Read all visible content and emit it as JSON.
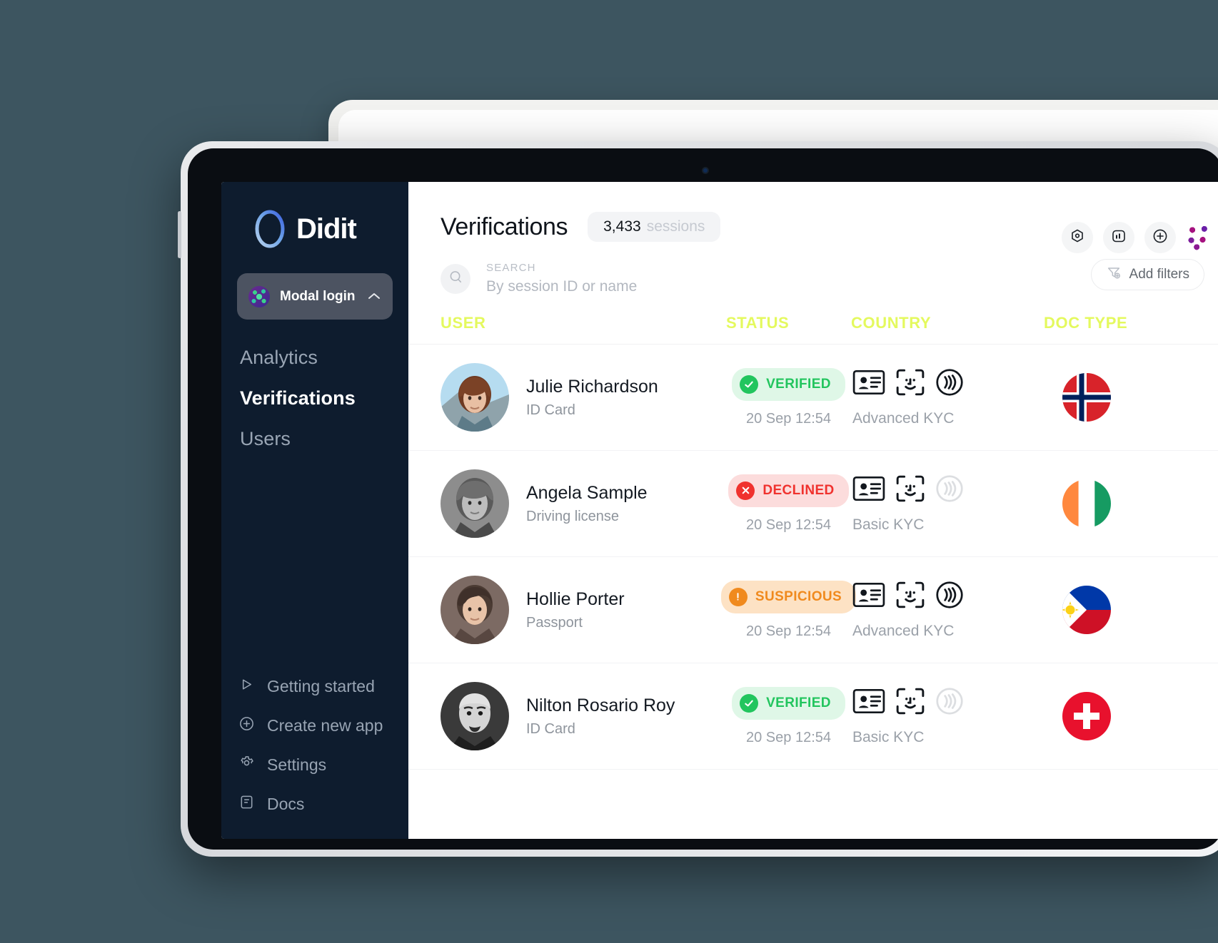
{
  "brand": {
    "name": "Didit",
    "logo_icon": "didit-ring-logo"
  },
  "app_switcher": {
    "label": "Modal login",
    "chevron": "chevron-up-icon",
    "avatar_icon": "app-avatar-identicon"
  },
  "sidebar": {
    "nav_main": [
      {
        "label": "Analytics",
        "active": false
      },
      {
        "label": "Verifications",
        "active": true
      },
      {
        "label": "Users",
        "active": false
      }
    ],
    "nav_bottom": [
      {
        "label": "Getting started",
        "icon": "play-outline-icon"
      },
      {
        "label": "Create new app",
        "icon": "plus-circle-icon"
      },
      {
        "label": "Settings",
        "icon": "gear-icon"
      },
      {
        "label": "Docs",
        "icon": "document-icon"
      }
    ]
  },
  "header": {
    "title": "Verifications",
    "sessions_count": "3,433",
    "sessions_unit": "sessions",
    "actions": [
      {
        "icon": "hexagon-target-icon"
      },
      {
        "icon": "bar-chart-icon"
      },
      {
        "icon": "plus-circle-icon"
      }
    ],
    "profile_icon": "user-dots-avatar"
  },
  "search": {
    "icon": "search-icon",
    "label": "SEARCH",
    "placeholder": "By session ID or name",
    "value": ""
  },
  "filters": {
    "label": "Add filters",
    "icon": "filter-plus-icon"
  },
  "table": {
    "header_color": "#e4f95e",
    "columns": [
      "USER",
      "STATUS",
      "COUNTRY",
      "DOC TYPE"
    ],
    "rows": [
      {
        "name": "Julie Richardson",
        "doc": "ID Card",
        "status": "VERIFIED",
        "status_kind": "verified",
        "timestamp": "20 Sep 12:54",
        "kyc_level": "Advanced KYC",
        "kyc_icons": [
          "id-card-icon",
          "face-scan-icon",
          "nfc-icon"
        ],
        "nfc_active": true,
        "flag": "norway-flag",
        "avatar": "woman-red-hair-photo"
      },
      {
        "name": "Angela Sample",
        "doc": "Driving license",
        "status": "DECLINED",
        "status_kind": "declined",
        "timestamp": "20 Sep 12:54",
        "kyc_level": "Basic KYC",
        "kyc_icons": [
          "id-card-icon",
          "face-scan-icon",
          "nfc-icon"
        ],
        "nfc_active": false,
        "flag": "ireland-flag",
        "avatar": "woman-grayscale-photo"
      },
      {
        "name": "Hollie Porter",
        "doc": "Passport",
        "status": "SUSPICIOUS",
        "status_kind": "suspicious",
        "timestamp": "20 Sep 12:54",
        "kyc_level": "Advanced KYC",
        "kyc_icons": [
          "id-card-icon",
          "face-scan-icon",
          "nfc-icon"
        ],
        "nfc_active": true,
        "flag": "philippines-flag",
        "avatar": "woman-short-hair-photo"
      },
      {
        "name": "Nilton Rosario Roy",
        "doc": "ID Card",
        "status": "VERIFIED",
        "status_kind": "verified",
        "timestamp": "20 Sep 12:54",
        "kyc_level": "Basic KYC",
        "kyc_icons": [
          "id-card-icon",
          "face-scan-icon",
          "nfc-icon"
        ],
        "nfc_active": false,
        "flag": "switzerland-flag",
        "avatar": "man-bald-photo"
      }
    ]
  },
  "colors": {
    "sidebar_bg": "#0e1c2e",
    "accent_yellow": "#e4f95e",
    "verified_green": "#22c55e",
    "declined_red": "#f0322e",
    "suspicious_orange": "#f08a1e"
  }
}
